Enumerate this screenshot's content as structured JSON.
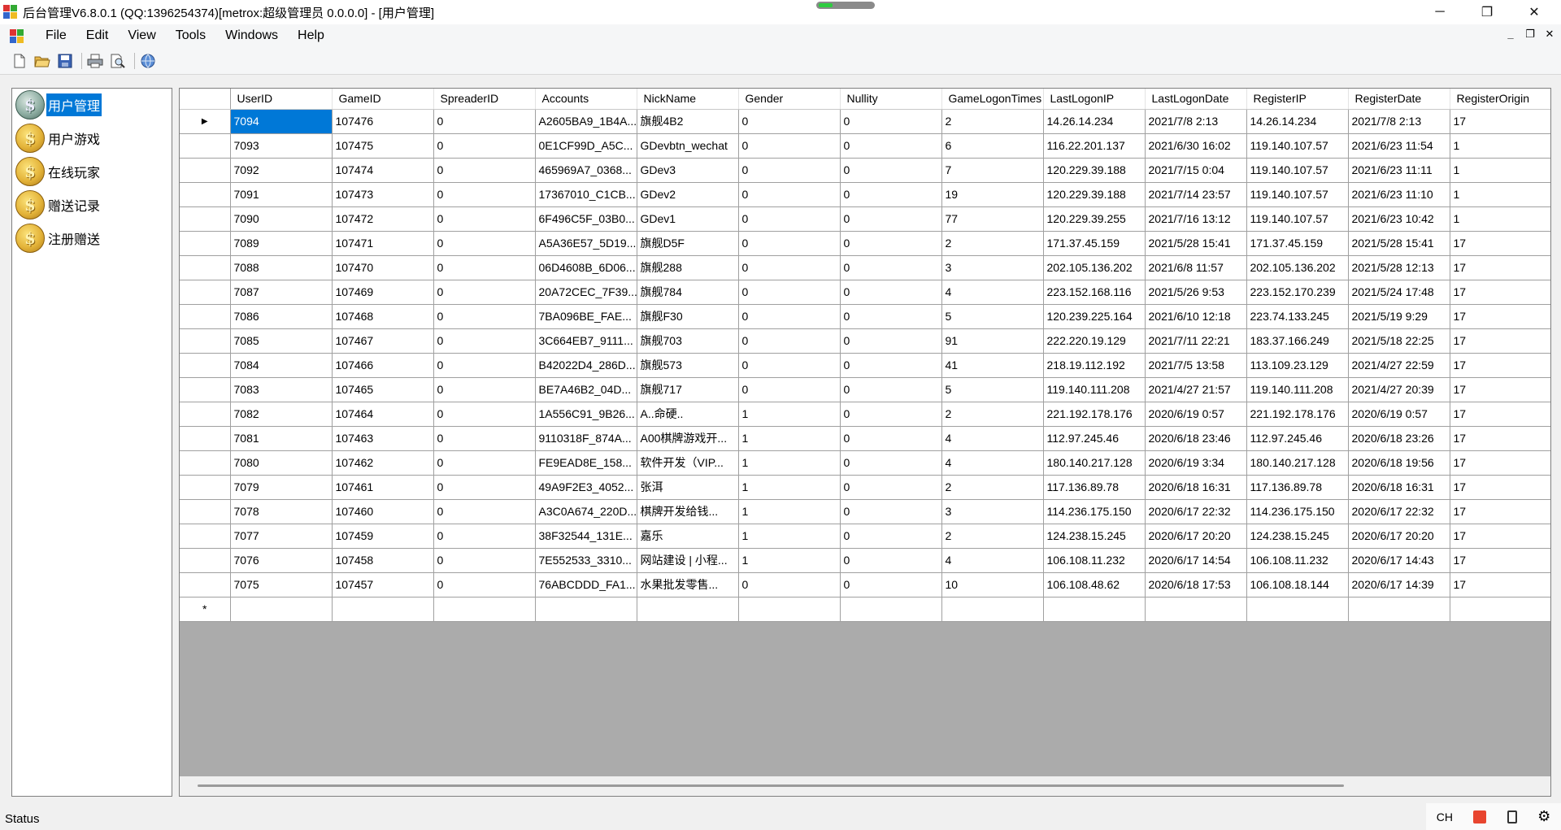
{
  "window": {
    "title": "后台管理V6.8.0.1 (QQ:1396254374)[metrox:超级管理员 0.0.0.0] - [用户管理]",
    "minimize_glyph": "─",
    "restore_glyph": "❐",
    "close_glyph": "✕",
    "progress_fraction": 0.25
  },
  "menu": {
    "items": [
      "File",
      "Edit",
      "View",
      "Tools",
      "Windows",
      "Help"
    ],
    "mdi_controls": [
      "_",
      "❐",
      "✕"
    ]
  },
  "toolbar": {
    "buttons": [
      "new-file-icon",
      "open-folder-icon",
      "save-icon",
      "print-icon",
      "print-preview-icon",
      "globe-icon"
    ]
  },
  "sidebar": {
    "items": [
      {
        "label": "用户管理",
        "selected": true,
        "coin_glyph": "$"
      },
      {
        "label": "用户游戏",
        "selected": false,
        "coin_glyph": "$"
      },
      {
        "label": "在线玩家",
        "selected": false,
        "coin_glyph": "$"
      },
      {
        "label": "赠送记录",
        "selected": false,
        "coin_glyph": "$"
      },
      {
        "label": "注册赠送",
        "selected": false,
        "coin_glyph": "$"
      }
    ]
  },
  "grid": {
    "columns": [
      "UserID",
      "GameID",
      "SpreaderID",
      "Accounts",
      "NickName",
      "Gender",
      "Nullity",
      "GameLogonTimes",
      "LastLogonIP",
      "LastLogonDate",
      "RegisterIP",
      "RegisterDate",
      "RegisterOrigin"
    ],
    "current_row_marker": "▶",
    "new_row_marker": "*",
    "rows": [
      [
        "7094",
        "107476",
        "0",
        "A2605BA9_1B4A...",
        "旗舰4B2",
        "0",
        "0",
        "2",
        "14.26.14.234",
        "2021/7/8 2:13",
        "14.26.14.234",
        "2021/7/8 2:13",
        "17"
      ],
      [
        "7093",
        "107475",
        "0",
        "0E1CF99D_A5C...",
        "GDevbtn_wechat",
        "0",
        "0",
        "6",
        "116.22.201.137",
        "2021/6/30 16:02",
        "119.140.107.57",
        "2021/6/23 11:54",
        "1"
      ],
      [
        "7092",
        "107474",
        "0",
        "465969A7_0368...",
        "GDev3",
        "0",
        "0",
        "7",
        "120.229.39.188",
        "2021/7/15 0:04",
        "119.140.107.57",
        "2021/6/23 11:11",
        "1"
      ],
      [
        "7091",
        "107473",
        "0",
        "17367010_C1CB...",
        "GDev2",
        "0",
        "0",
        "19",
        "120.229.39.188",
        "2021/7/14 23:57",
        "119.140.107.57",
        "2021/6/23 11:10",
        "1"
      ],
      [
        "7090",
        "107472",
        "0",
        "6F496C5F_03B0...",
        "GDev1",
        "0",
        "0",
        "77",
        "120.229.39.255",
        "2021/7/16 13:12",
        "119.140.107.57",
        "2021/6/23 10:42",
        "1"
      ],
      [
        "7089",
        "107471",
        "0",
        "A5A36E57_5D19...",
        "旗舰D5F",
        "0",
        "0",
        "2",
        "171.37.45.159",
        "2021/5/28 15:41",
        "171.37.45.159",
        "2021/5/28 15:41",
        "17"
      ],
      [
        "7088",
        "107470",
        "0",
        "06D4608B_6D06...",
        "旗舰288",
        "0",
        "0",
        "3",
        "202.105.136.202",
        "2021/6/8 11:57",
        "202.105.136.202",
        "2021/5/28 12:13",
        "17"
      ],
      [
        "7087",
        "107469",
        "0",
        "20A72CEC_7F39...",
        "旗舰784",
        "0",
        "0",
        "4",
        "223.152.168.116",
        "2021/5/26 9:53",
        "223.152.170.239",
        "2021/5/24 17:48",
        "17"
      ],
      [
        "7086",
        "107468",
        "0",
        "7BA096BE_FAE...",
        "旗舰F30",
        "0",
        "0",
        "5",
        "120.239.225.164",
        "2021/6/10 12:18",
        "223.74.133.245",
        "2021/5/19 9:29",
        "17"
      ],
      [
        "7085",
        "107467",
        "0",
        "3C664EB7_9111...",
        "旗舰703",
        "0",
        "0",
        "91",
        "222.220.19.129",
        "2021/7/11 22:21",
        "183.37.166.249",
        "2021/5/18 22:25",
        "17"
      ],
      [
        "7084",
        "107466",
        "0",
        "B42022D4_286D...",
        "旗舰573",
        "0",
        "0",
        "41",
        "218.19.112.192",
        "2021/7/5 13:58",
        "113.109.23.129",
        "2021/4/27 22:59",
        "17"
      ],
      [
        "7083",
        "107465",
        "0",
        "BE7A46B2_04D...",
        "旗舰717",
        "0",
        "0",
        "5",
        "119.140.111.208",
        "2021/4/27 21:57",
        "119.140.111.208",
        "2021/4/27 20:39",
        "17"
      ],
      [
        "7082",
        "107464",
        "0",
        "1A556C91_9B26...",
        "A..命硬..",
        "1",
        "0",
        "2",
        "221.192.178.176",
        "2020/6/19 0:57",
        "221.192.178.176",
        "2020/6/19 0:57",
        "17"
      ],
      [
        "7081",
        "107463",
        "0",
        "9110318F_874A...",
        "A00棋牌游戏开...",
        "1",
        "0",
        "4",
        "112.97.245.46",
        "2020/6/18 23:46",
        "112.97.245.46",
        "2020/6/18 23:26",
        "17"
      ],
      [
        "7080",
        "107462",
        "0",
        "FE9EAD8E_158...",
        "软件开发（VIP...",
        "1",
        "0",
        "4",
        "180.140.217.128",
        "2020/6/19 3:34",
        "180.140.217.128",
        "2020/6/18 19:56",
        "17"
      ],
      [
        "7079",
        "107461",
        "0",
        "49A9F2E3_4052...",
        "张洱",
        "1",
        "0",
        "2",
        "117.136.89.78",
        "2020/6/18 16:31",
        "117.136.89.78",
        "2020/6/18 16:31",
        "17"
      ],
      [
        "7078",
        "107460",
        "0",
        "A3C0A674_220D...",
        "棋牌开发给钱...",
        "1",
        "0",
        "3",
        "114.236.175.150",
        "2020/6/17 22:32",
        "114.236.175.150",
        "2020/6/17 22:32",
        "17"
      ],
      [
        "7077",
        "107459",
        "0",
        "38F32544_131E...",
        "嘉乐",
        "1",
        "0",
        "2",
        "124.238.15.245",
        "2020/6/17 20:20",
        "124.238.15.245",
        "2020/6/17 20:20",
        "17"
      ],
      [
        "7076",
        "107458",
        "0",
        "7E552533_3310...",
        "网站建设 | 小程...",
        "1",
        "0",
        "4",
        "106.108.11.232",
        "2020/6/17 14:54",
        "106.108.11.232",
        "2020/6/17 14:43",
        "17"
      ],
      [
        "7075",
        "107457",
        "0",
        "76ABCDDD_FA1...",
        "水果批发零售...",
        "0",
        "0",
        "10",
        "106.108.48.62",
        "2020/6/18 17:53",
        "106.108.18.144",
        "2020/6/17 14:39",
        "17"
      ]
    ]
  },
  "status": {
    "text": "Status"
  },
  "tray": {
    "ime": "CH"
  }
}
